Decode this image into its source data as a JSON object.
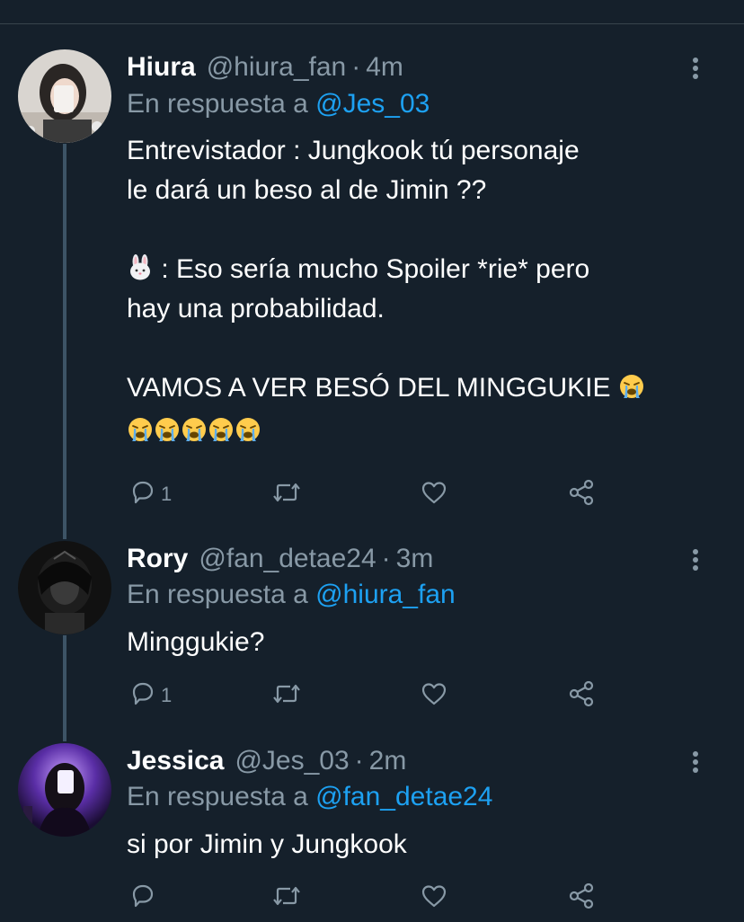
{
  "tweets": [
    {
      "name": "Hiura",
      "handle": "@hiura_fan",
      "separator": "·",
      "time": "4m",
      "reply_prefix": "En respuesta a",
      "reply_to": "@Jes_03",
      "lines": [
        "Entrevistador : Jungkook tú personaje",
        "le dará un beso al de Jimin ??",
        "",
        " : Eso sería mucho Spoiler *rie* pero",
        "hay una probabilidad.",
        "",
        "VAMOS A VER BESÓ DEL MINGGUKIE "
      ],
      "reply_count": "1",
      "emoji_prefix": "rabbit-face-emoji",
      "emoji_trailing": "loudly-crying-face-emoji",
      "emoji_row_count": 5
    },
    {
      "name": "Rory",
      "handle": "@fan_detae24",
      "separator": "·",
      "time": "3m",
      "reply_prefix": "En respuesta a",
      "reply_to": "@hiura_fan",
      "lines": [
        "Minggukie?"
      ],
      "reply_count": "1"
    },
    {
      "name": "Jessica",
      "handle": "@Jes_03",
      "separator": "·",
      "time": "2m",
      "reply_prefix": "En respuesta a",
      "reply_to": "@fan_detae24",
      "lines": [
        "si por Jimin y Jungkook"
      ],
      "reply_count": ""
    }
  ],
  "colors": {
    "background": "#15202b",
    "secondary_text": "#8899a6",
    "link": "#1da1f2",
    "thread_line": "#3d5466"
  },
  "icons": [
    "reply-icon",
    "retweet-icon",
    "like-icon",
    "share-icon",
    "more-options-icon"
  ]
}
